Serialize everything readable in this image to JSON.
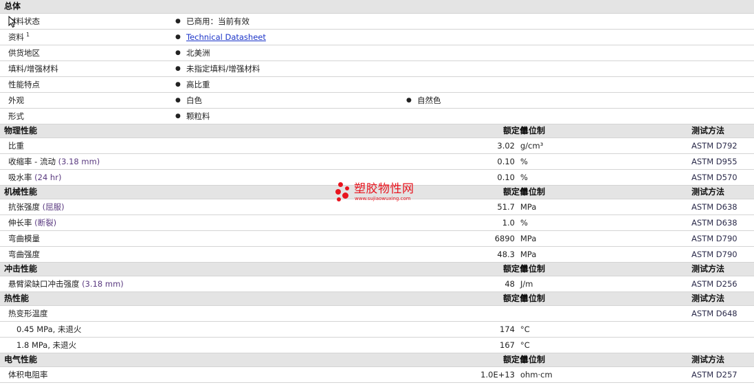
{
  "general": {
    "title": "总体",
    "rows": [
      {
        "label": "材料状态",
        "values": [
          "已商用：当前有效"
        ]
      },
      {
        "label": "资料",
        "sup": "1",
        "values": [
          "Technical Datasheet"
        ],
        "link": true
      },
      {
        "label": "供货地区",
        "values": [
          "北美洲"
        ]
      },
      {
        "label": "填料/增强材料",
        "values": [
          "未指定填料/增强材料"
        ]
      },
      {
        "label": "性能特点",
        "values": [
          "高比重"
        ]
      },
      {
        "label": "外观",
        "values": [
          "白色",
          "自然色"
        ]
      },
      {
        "label": "形式",
        "values": [
          "颗粒料"
        ]
      }
    ]
  },
  "column_headers": {
    "value": "额定值",
    "unit": "单位制",
    "test": "测试方法"
  },
  "sections": [
    {
      "title": "物理性能",
      "rows": [
        {
          "label": "比重",
          "cond": "",
          "value": "3.02",
          "unit": "g/cm³",
          "test": "ASTM D792"
        },
        {
          "label": "收缩率 - 流动",
          "cond": "(3.18 mm)",
          "value": "0.10",
          "unit": "%",
          "test": "ASTM D955"
        },
        {
          "label": "吸水率",
          "cond": "(24 hr)",
          "value": "0.10",
          "unit": "%",
          "test": "ASTM D570"
        }
      ]
    },
    {
      "title": "机械性能",
      "rows": [
        {
          "label": "抗张强度",
          "cond": "(屈服)",
          "value": "51.7",
          "unit": "MPa",
          "test": "ASTM D638"
        },
        {
          "label": "伸长率",
          "cond": "(断裂)",
          "value": "1.0",
          "unit": "%",
          "test": "ASTM D638"
        },
        {
          "label": "弯曲模量",
          "cond": "",
          "value": "6890",
          "unit": "MPa",
          "test": "ASTM D790"
        },
        {
          "label": "弯曲强度",
          "cond": "",
          "value": "48.3",
          "unit": "MPa",
          "test": "ASTM D790"
        }
      ]
    },
    {
      "title": "冲击性能",
      "rows": [
        {
          "label": "悬臂梁缺口冲击强度",
          "cond": "(3.18 mm)",
          "value": "48",
          "unit": "J/m",
          "test": "ASTM D256"
        }
      ]
    },
    {
      "title": "热性能",
      "rows": [
        {
          "label": "热变形温度",
          "cond": "",
          "value": "",
          "unit": "",
          "test": "ASTM D648"
        },
        {
          "label": "0.45 MPa, 未退火",
          "cond": "",
          "value": "174",
          "unit": "°C",
          "test": "",
          "sub": true
        },
        {
          "label": "1.8 MPa, 未退火",
          "cond": "",
          "value": "167",
          "unit": "°C",
          "test": "",
          "sub": true
        }
      ]
    },
    {
      "title": "电气性能",
      "rows": [
        {
          "label": "体积电阻率",
          "cond": "",
          "value": "1.0E+13",
          "unit": "ohm·cm",
          "test": "ASTM D257"
        }
      ]
    }
  ],
  "watermark": {
    "text": "塑胶物性网",
    "url": "www.sujiaowuxing.com",
    "color": "#e8141e"
  },
  "colors": {
    "header_bg": "#e4e4e4",
    "link": "#1a33c8",
    "condition": "#5a3a80"
  }
}
